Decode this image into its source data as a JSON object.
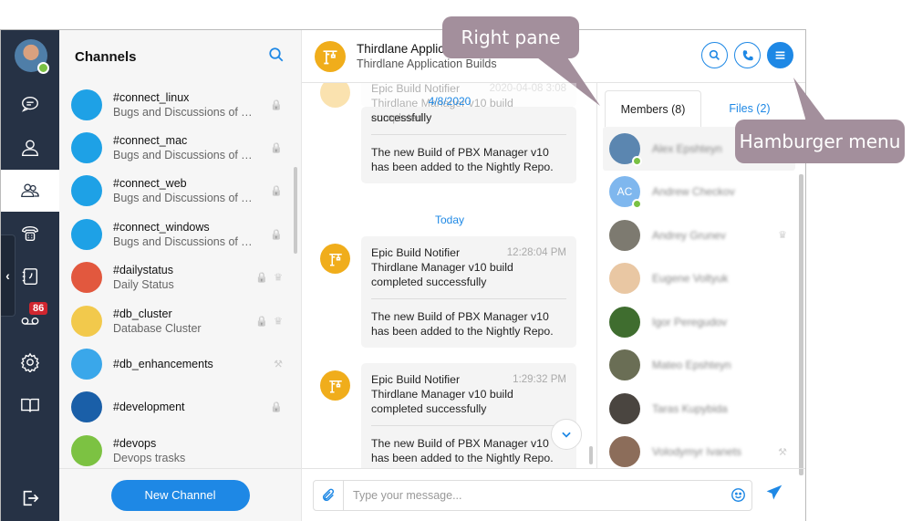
{
  "rail": {
    "badge_count": "86",
    "items": [
      "chats-icon",
      "contacts-icon",
      "channels-icon",
      "phone-icon",
      "call-log-icon",
      "voicemail-icon",
      "settings-icon",
      "help-book-icon"
    ]
  },
  "channels": {
    "title": "Channels",
    "items": [
      {
        "name": "#connect_linux",
        "desc": "Bugs and Discussions of Thir...",
        "color": "#1ea1e6",
        "flags": [
          "lock"
        ]
      },
      {
        "name": "#connect_mac",
        "desc": "Bugs and Discussions of Thir...",
        "color": "#1ea1e6",
        "flags": [
          "lock"
        ]
      },
      {
        "name": "#connect_web",
        "desc": "Bugs and Discussions of Thir...",
        "color": "#1ea1e6",
        "flags": [
          "lock"
        ]
      },
      {
        "name": "#connect_windows",
        "desc": "Bugs and Discussions of Thir...",
        "color": "#1ea1e6",
        "flags": [
          "lock"
        ]
      },
      {
        "name": "#dailystatus",
        "desc": "Daily Status",
        "color": "#e2583e",
        "flags": [
          "lock",
          "crown"
        ]
      },
      {
        "name": "#db_cluster",
        "desc": "Database Cluster",
        "color": "#f2c94c",
        "flags": [
          "lock",
          "crown"
        ]
      },
      {
        "name": "#db_enhancements",
        "desc": "",
        "color": "#3aa7ea",
        "flags": [
          "gavel"
        ]
      },
      {
        "name": "#development",
        "desc": "",
        "color": "#1a5fa8",
        "flags": [
          "lock"
        ]
      },
      {
        "name": "#devops",
        "desc": "Devops trasks",
        "color": "#7cc242",
        "flags": []
      }
    ],
    "new_channel_label": "New Channel"
  },
  "room": {
    "title": "Thirdlane Application Builds",
    "title_visible": "Thirdlane Applic",
    "subtitle": "Thirdlane Application Builds"
  },
  "chat": {
    "faded_header": {
      "sender": "Epic Build Notifier",
      "time": "2020-04-08 3:08",
      "line": "Thirdlane Manager v10 build completed"
    },
    "date_overlay": "4/8/2020",
    "first_partial": {
      "line": "successfully",
      "body": "The new Build of PBX Manager v10 has been added to the Nightly Repo."
    },
    "separator": "Today",
    "messages": [
      {
        "sender": "Epic Build Notifier",
        "time": "12:28:04 PM",
        "text": "Thirdlane Manager v10 build completed successfully",
        "body": "The new Build of PBX Manager v10 has been added to the Nightly Repo."
      },
      {
        "sender": "Epic Build Notifier",
        "time": "1:29:32 PM",
        "text": "Thirdlane Manager v10 build completed successfully",
        "body": "The new Build of PBX Manager v10 has been added to the Nightly Repo."
      }
    ]
  },
  "right_pane": {
    "tabs": [
      "Members (8)",
      "Files (2)"
    ],
    "members": [
      {
        "name": "Alex Epshteyn",
        "initials": "",
        "color": "#5b86b0",
        "online": true,
        "flag": ""
      },
      {
        "name": "Andrew Checkov",
        "initials": "AC",
        "color": "#7fb7ee",
        "online": true,
        "flag": ""
      },
      {
        "name": "Andrey Grunev",
        "initials": "",
        "color": "#7d7a70",
        "online": false,
        "flag": "crown"
      },
      {
        "name": "Eugene Voltyuk",
        "initials": "",
        "color": "#e9c7a3",
        "online": false,
        "flag": ""
      },
      {
        "name": "Igor Peregudov",
        "initials": "",
        "color": "#3f6d2f",
        "online": false,
        "flag": ""
      },
      {
        "name": "Mateo Epshteyn",
        "initials": "",
        "color": "#6a6e55",
        "online": false,
        "flag": ""
      },
      {
        "name": "Taras Kupybida",
        "initials": "",
        "color": "#4a4540",
        "online": false,
        "flag": ""
      },
      {
        "name": "Volodymyr Ivanets",
        "initials": "",
        "color": "#8c6d5a",
        "online": false,
        "flag": "gavel"
      }
    ]
  },
  "composer": {
    "placeholder": "Type your message..."
  },
  "callouts": {
    "right_pane": "Right pane",
    "hamburger": "Hamburger menu"
  },
  "icons": {
    "lock": "🔒",
    "crown": "♛",
    "gavel": "⚒"
  }
}
